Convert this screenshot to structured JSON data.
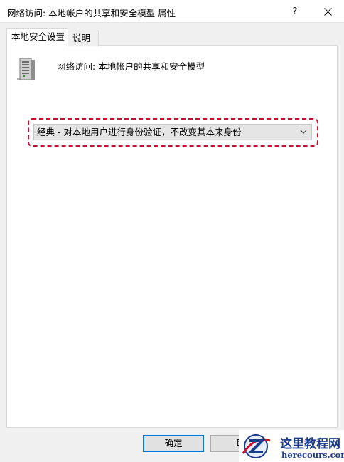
{
  "window": {
    "title": "网络访问: 本地帐户的共享和安全模型 属性",
    "help_label": "?",
    "close_icon": "close-icon"
  },
  "tabs": [
    {
      "label": "本地安全设置",
      "active": true
    },
    {
      "label": "说明",
      "active": false
    }
  ],
  "policy": {
    "icon": "server-icon",
    "title": "网络访问: 本地帐户的共享和安全模型"
  },
  "combo": {
    "selected": "经典 - 对本地用户进行身份验证，不改变其本来身份",
    "arrow_icon": "chevron-down-icon"
  },
  "buttons": {
    "ok_label": "确定",
    "cancel_label": "取"
  },
  "watermark": {
    "logo_icon": "z-globe-logo",
    "cn_text": "这里教程网",
    "en_text": "herecours.com"
  },
  "colors": {
    "highlight": "#c8102e",
    "accent": "#0078d7",
    "watermark_text": "#1a3b8c"
  }
}
